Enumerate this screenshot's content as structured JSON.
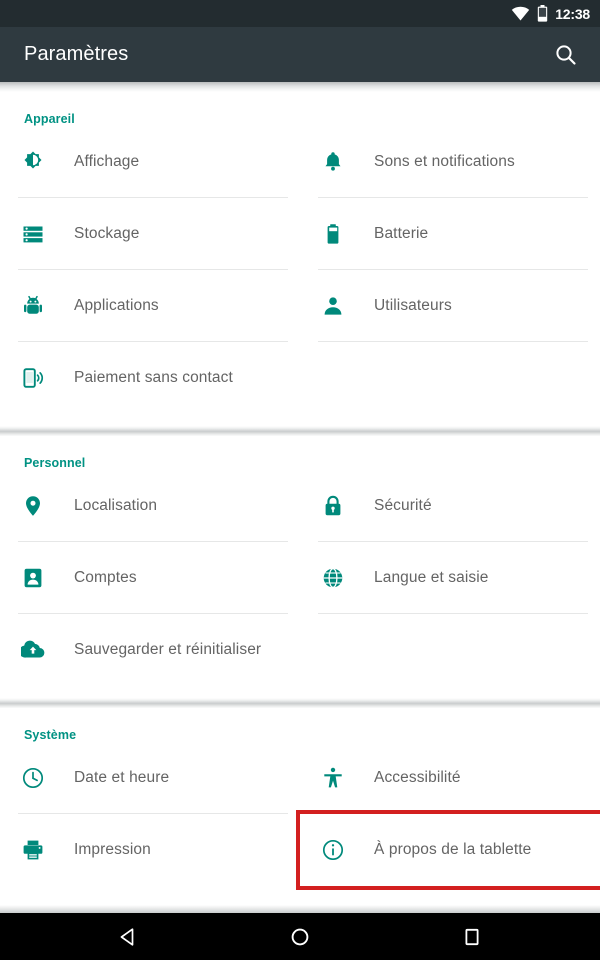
{
  "status_bar": {
    "time": "12:38",
    "icons": [
      "wifi-icon",
      "battery-icon"
    ]
  },
  "action_bar": {
    "title": "Paramètres",
    "search_icon": "search-icon"
  },
  "sections": [
    {
      "id": "appareil",
      "header": "Appareil",
      "items": [
        {
          "label": "Affichage",
          "icon": "brightness-icon"
        },
        {
          "label": "Sons et notifications",
          "icon": "bell-icon"
        },
        {
          "label": "Stockage",
          "icon": "storage-list-icon"
        },
        {
          "label": "Batterie",
          "icon": "battery-icon"
        },
        {
          "label": "Applications",
          "icon": "android-robot-icon"
        },
        {
          "label": "Utilisateurs",
          "icon": "person-icon"
        },
        {
          "label": "Paiement sans contact",
          "icon": "nfc-phone-icon"
        }
      ]
    },
    {
      "id": "personnel",
      "header": "Personnel",
      "items": [
        {
          "label": "Localisation",
          "icon": "map-pin-icon"
        },
        {
          "label": "Sécurité",
          "icon": "lock-icon"
        },
        {
          "label": "Comptes",
          "icon": "contact-card-icon"
        },
        {
          "label": "Langue et saisie",
          "icon": "globe-icon"
        },
        {
          "label": "Sauvegarder et réinitialiser",
          "icon": "cloud-upload-icon"
        }
      ]
    },
    {
      "id": "systeme",
      "header": "Système",
      "items": [
        {
          "label": "Date et heure",
          "icon": "clock-icon"
        },
        {
          "label": "Accessibilité",
          "icon": "accessibility-icon"
        },
        {
          "label": "Impression",
          "icon": "printer-icon"
        },
        {
          "label": "À propos de la tablette",
          "icon": "info-icon",
          "highlighted": true
        }
      ]
    }
  ],
  "nav_bar": {
    "back": "back-triangle-icon",
    "home": "home-circle-icon",
    "recents": "recents-square-icon"
  },
  "colors": {
    "accent_teal": "#009283",
    "icon_teal": "#00897b",
    "status_bar_bg": "#232c30",
    "action_bar_bg": "#2f3a40",
    "label_text": "#646464",
    "highlight_red": "#d32020",
    "divider": "#e6e7e7"
  }
}
